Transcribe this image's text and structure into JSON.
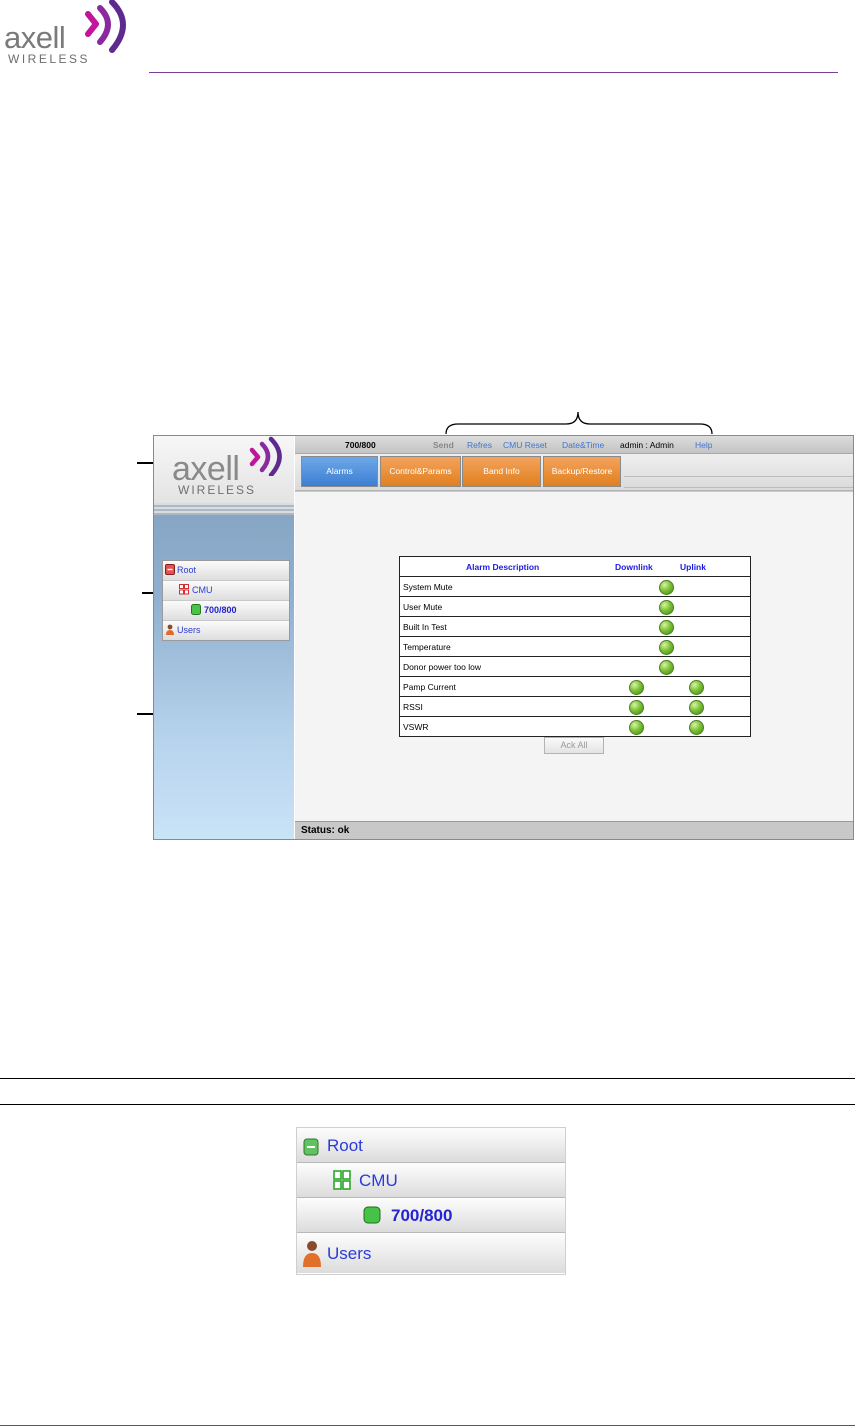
{
  "brand": {
    "name": "axell",
    "sub": "WIRELESS",
    "accent": "#7b3f9a"
  },
  "screenshot": {
    "topbar": {
      "device": "700/800",
      "send": "Send",
      "refresh": "Refres",
      "cmu_reset": "CMU Reset",
      "datetime": "Date&Time",
      "user": "admin : Admin",
      "help": "Help"
    },
    "tabs": [
      "Alarms",
      "Control&Params",
      "Band Info",
      "Backup/Restore"
    ],
    "tree": {
      "root": "Root",
      "cmu": "CMU",
      "device": "700/800",
      "users": "Users"
    },
    "alarm_table": {
      "headers": {
        "description": "Alarm Description",
        "downlink": "Downlink",
        "uplink": "Uplink"
      },
      "rows": [
        {
          "label": "System Mute",
          "downlink": true,
          "uplink": false
        },
        {
          "label": "User Mute",
          "downlink": true,
          "uplink": false
        },
        {
          "label": "Built In Test",
          "downlink": true,
          "uplink": false
        },
        {
          "label": "Temperature",
          "downlink": true,
          "uplink": false
        },
        {
          "label": "Donor power too low",
          "downlink": true,
          "uplink": false
        },
        {
          "label": "Pamp Current",
          "downlink": true,
          "uplink": true
        },
        {
          "label": "RSSI",
          "downlink": true,
          "uplink": true
        },
        {
          "label": "VSWR",
          "downlink": true,
          "uplink": true
        }
      ],
      "ack_all": "Ack All"
    },
    "status": "Status: ok"
  },
  "zoom_tree": {
    "root": "Root",
    "cmu": "CMU",
    "device": "700/800",
    "users": "Users"
  }
}
